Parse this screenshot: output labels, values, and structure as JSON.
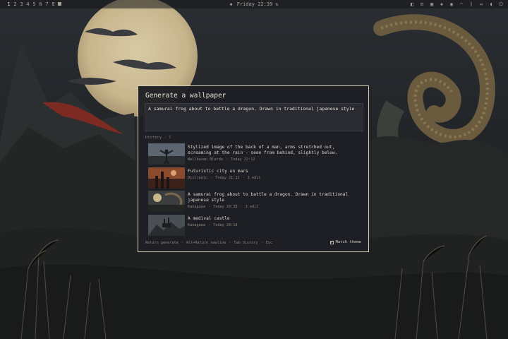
{
  "topbar": {
    "workspaces": [
      "1",
      "2",
      "3",
      "4",
      "5",
      "6",
      "7",
      "8",
      "9"
    ],
    "active_workspace": "1",
    "clock": "Friday 22:39",
    "tray_icons": [
      "screenshot-icon",
      "tray-icon",
      "lock-icon",
      "tray-icon",
      "tray-icon",
      "wifi-icon",
      "bluetooth-icon",
      "display-icon",
      "sound-icon",
      "power-icon"
    ]
  },
  "dialog": {
    "title": "Generate a wallpaper",
    "prompt_value": "A samurai frog about to battle a dragon. Drawn in traditional japanese style",
    "history_label": "History · 7",
    "history": [
      {
        "title": "Stylized image of the back of a man, arms stretched out, screaming at the rain - seen from behind, slightly below.",
        "model": "Wellhaven Blurdo",
        "time": "Today 22:12",
        "edits": ""
      },
      {
        "title": "Futuristic city on mars",
        "model": "Distreeto",
        "time": "Today 21:12",
        "edits": "1 edit"
      },
      {
        "title": "A samurai frog about to battle a dragon. Drawn in traditional japanese style",
        "model": "Kanagawa",
        "time": "Today 20:38",
        "edits": "1 edit"
      },
      {
        "title": "A medival castle",
        "model": "Kanagawa",
        "time": "Today 20:18",
        "edits": ""
      }
    ],
    "footer": {
      "return": "Return generate",
      "newline": "Alt+Return newline",
      "tab": "Tab history",
      "esc": "Esc"
    },
    "match_theme_label": "Match theme",
    "match_theme_checked": true
  },
  "colors": {
    "dialog_bg": "#1e1f24",
    "dialog_border": "#d6cfb6",
    "accent_text": "#ece6d9",
    "muted_text": "#8a867e"
  }
}
